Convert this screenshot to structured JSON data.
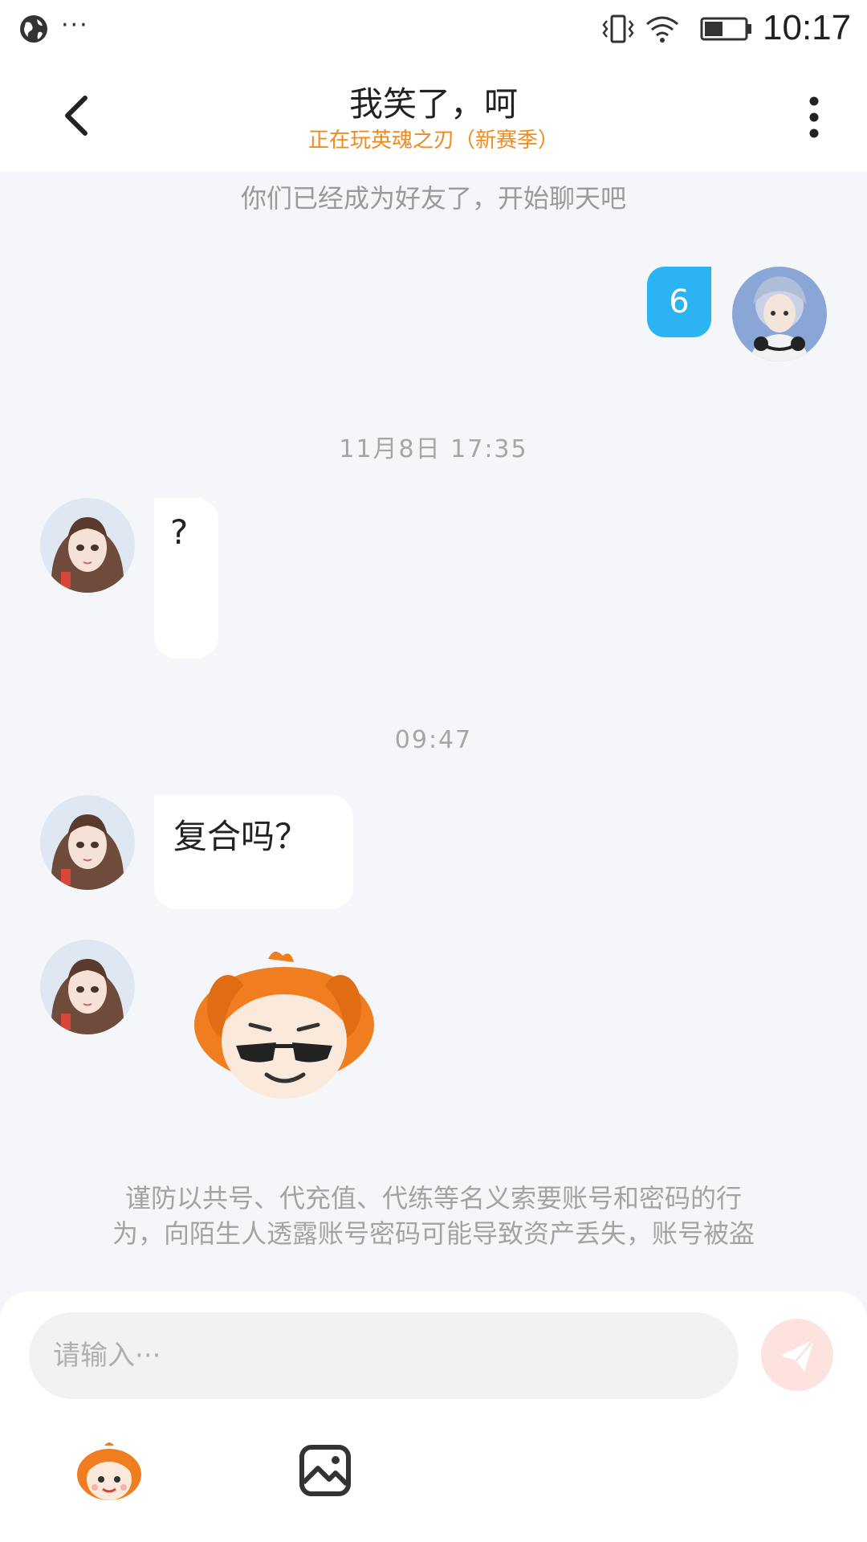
{
  "status_bar": {
    "time": "10:17",
    "more_dots": "···",
    "icons": [
      "globe-icon",
      "vibrate-icon",
      "wifi-icon",
      "battery-icon"
    ]
  },
  "header": {
    "title": "我笑了，呵",
    "subtitle": "正在玩英魂之刃（新赛季）",
    "icons": [
      "back-arrow-icon",
      "more-vertical-icon"
    ]
  },
  "chat": {
    "system_message": "你们已经成为好友了，开始聊天吧",
    "messages": [
      {
        "sender": "me",
        "type": "text",
        "text": "6"
      },
      {
        "type": "timestamp",
        "text": "11月8日 17:35"
      },
      {
        "sender": "other",
        "type": "text",
        "text": "?"
      },
      {
        "type": "timestamp",
        "text": "09:47"
      },
      {
        "sender": "other",
        "type": "text",
        "text": "复合吗？"
      },
      {
        "sender": "other",
        "type": "sticker",
        "icon": "sunglasses-mascot-sticker"
      }
    ],
    "warning_line1": "谨防以共号、代充值、代练等名义索要账号和密码的行",
    "warning_line2": "为，向陌生人透露账号密码可能导致资产丢失，账号被盗"
  },
  "input": {
    "placeholder": "请输入···",
    "value": "",
    "send_icon": "paper-plane-icon",
    "toolbar_icons": [
      "emoji-mascot-icon",
      "image-icon"
    ]
  },
  "colors": {
    "accent_blue": "#2bb3f3",
    "subtitle_orange": "#f08a1e",
    "send_button_bg": "#fde3e0",
    "chat_background": "#f4f6f9"
  }
}
